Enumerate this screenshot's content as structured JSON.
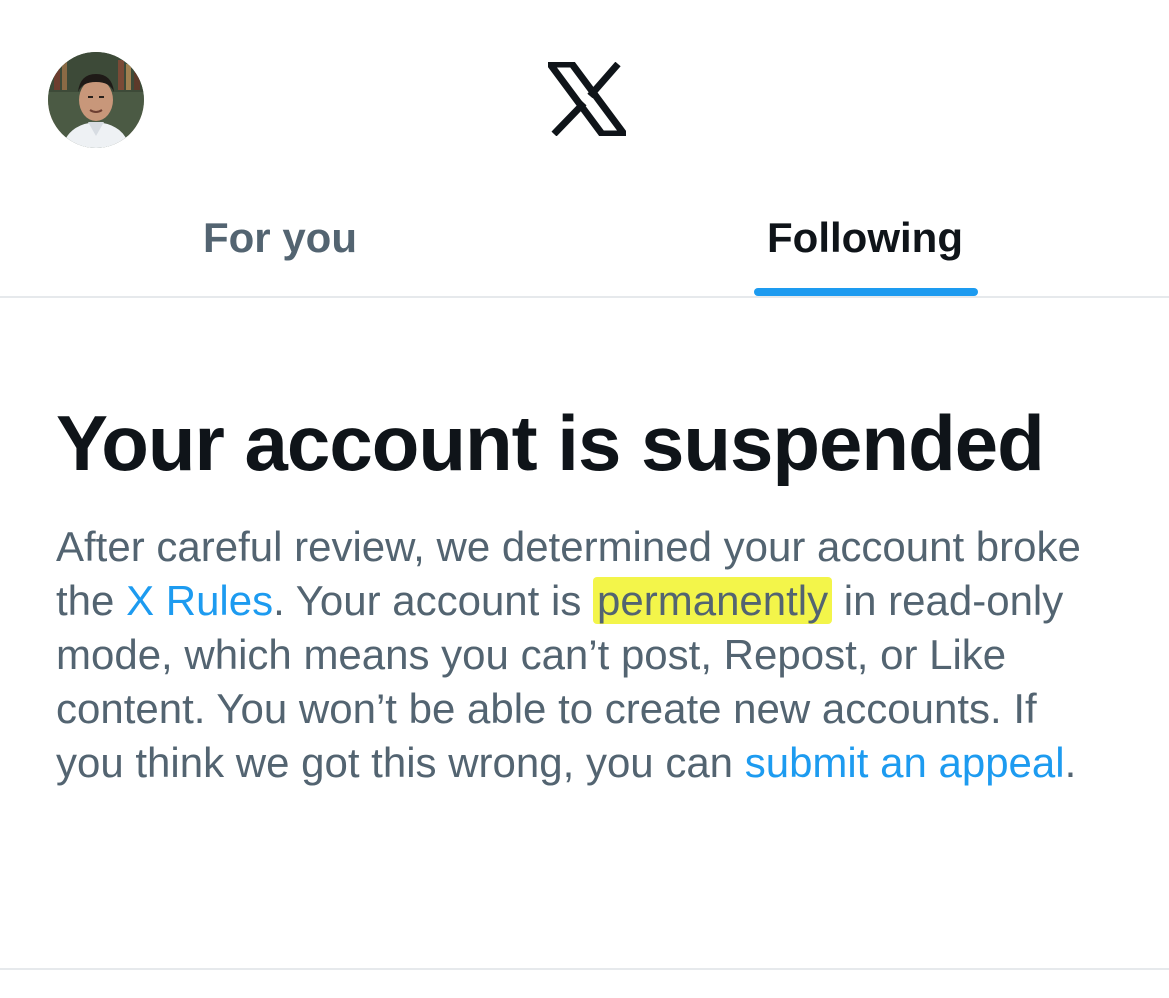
{
  "header": {
    "avatar_alt": "profile photo",
    "logo_icon": "x-logo-icon"
  },
  "tabs": [
    {
      "label": "For you",
      "selected": false
    },
    {
      "label": "Following",
      "selected": true
    }
  ],
  "colors": {
    "accent": "#1d9bf0",
    "text_primary": "#0f1419",
    "text_secondary": "#536471",
    "highlight": "#f3f54a"
  },
  "notice": {
    "title": "Your account is suspended",
    "body": {
      "part1": "After careful review, we determined your account broke the ",
      "rules_link": "X Rules",
      "part2": ". Your account is ",
      "highlighted": "permanently",
      "part3": " in read-only mode, which means you can’t post, Repost, or Like content. You won’t be able to create new accounts. If you think we got this wrong, you can ",
      "appeal_link": "submit an appeal",
      "part4": "."
    }
  }
}
